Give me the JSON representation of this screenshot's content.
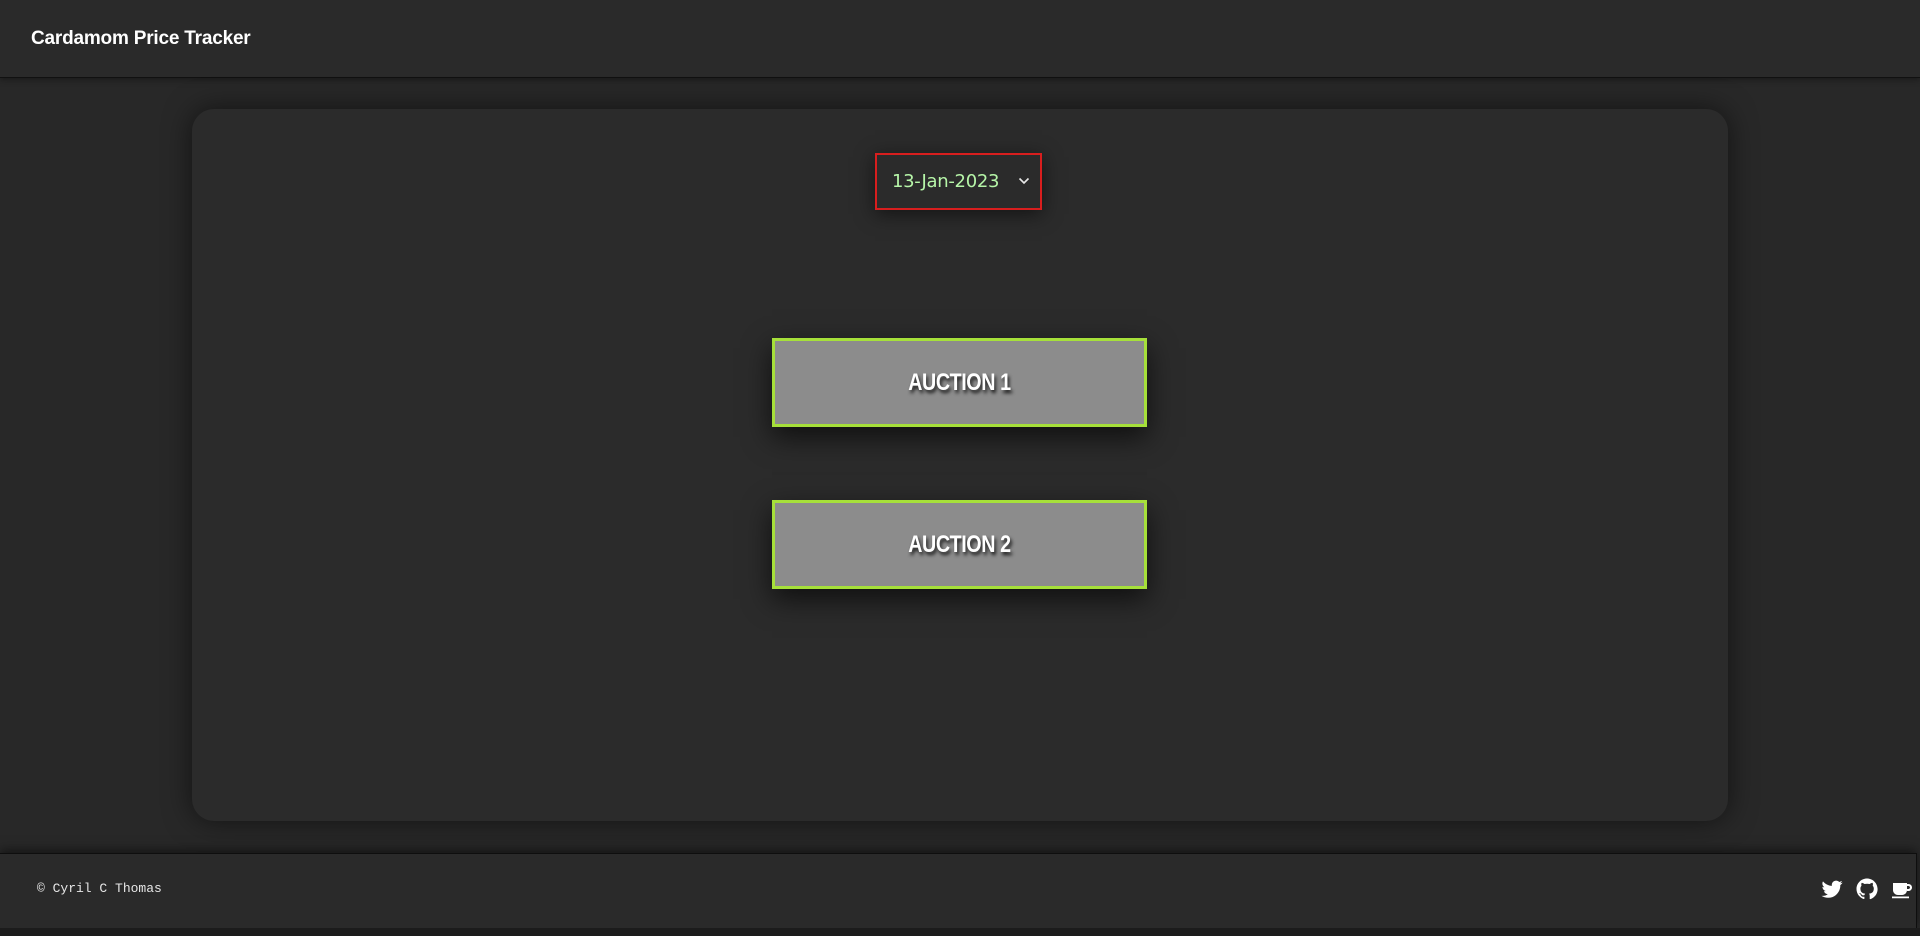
{
  "header": {
    "brand": "Cardamom Price Tracker"
  },
  "date_selector": {
    "selected": "13-Jan-2023"
  },
  "auctions": [
    {
      "label": "Auction 1"
    },
    {
      "label": "Auction 2"
    }
  ],
  "footer": {
    "copyright": "© Cyril C Thomas",
    "social_icons": [
      "twitter-icon",
      "github-icon",
      "coffee-icon"
    ]
  },
  "colors": {
    "background": "#282828",
    "select_border": "#d81e1e",
    "date_text": "#b6f5a8",
    "button_fill": "#8c8c8c",
    "button_border": "#a6e03a"
  }
}
